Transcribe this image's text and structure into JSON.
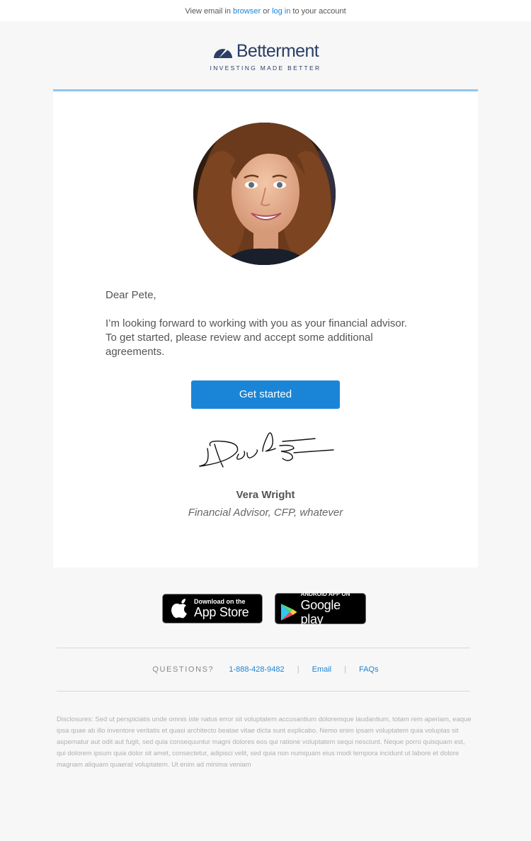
{
  "topbar": {
    "prefix": "View email in",
    "browser_link": "browser",
    "or": "or",
    "login_link": "log in",
    "suffix": "to your account"
  },
  "brand": {
    "name": "Betterment",
    "tagline": "INVESTING MADE BETTER",
    "color": "#2a3e66",
    "accent": "#1a85d6"
  },
  "email": {
    "greeting": "Dear Pete,",
    "body": "I’m looking forward to working with you as your financial advisor. To get started, please review and accept some additional agreements.",
    "cta_label": "Get started",
    "signer_name": "Vera Wright",
    "signer_title": "Financial Advisor, CFP, whatever"
  },
  "app_badges": {
    "apple_small": "Download on the",
    "apple_big": "App Store",
    "google_small": "ANDROID APP ON",
    "google_big": "Google play"
  },
  "footer": {
    "questions_label": "QUESTIONS?",
    "phone": "1-888-428-9482",
    "email_link": "Email",
    "faq_link": "FAQs",
    "separator": "|",
    "disclosure": "Disclosures: Sed ut perspiciatis unde omnis iste natus error sit voluptatem accusantium doloremque laudantium, totam rem aperiam, eaque ipsa quae ab illo inventore veritatis et quasi architecto beatae vitae dicta sunt explicabo. Nemo enim ipsam voluptatem quia voluptas sit aspernatur aut odit aut fugit, sed quia consequuntur magni dolores eos qui ratione voluptatem sequi nesciunt. Neque porro quisquam est, qui dolorem ipsum quia dolor sit amet, consectetur, adipisci velit, sed quia non numquam eius modi tempora incidunt ut labore et dolore magnam aliquam quaerat voluptatem. Ut enim ad minima veniam"
  }
}
